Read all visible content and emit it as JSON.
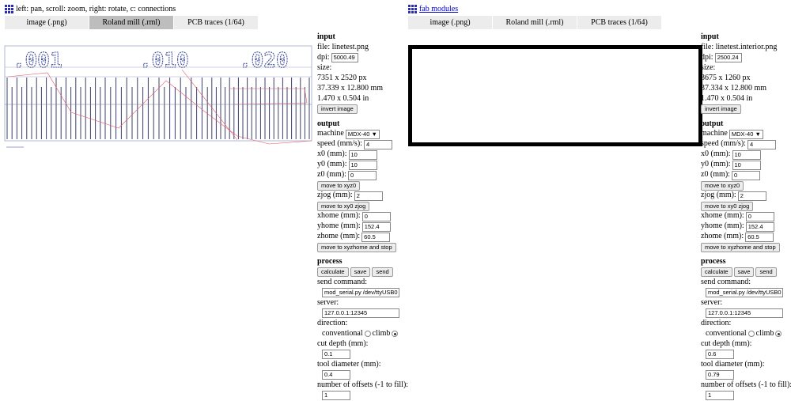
{
  "left": {
    "header": "left: pan, scroll: zoom, right: rotate, c: connections",
    "tabs": [
      "image (.png)",
      "Roland mill (.rml)",
      "PCB traces (1/64)"
    ],
    "preview_labels": [
      ".001",
      ".010",
      ".020"
    ],
    "input": {
      "title": "input",
      "file": "file: linetest.png",
      "dpi_label": "dpi:",
      "dpi": "5000.49",
      "size": "size:",
      "px": "7351 x 2520 px",
      "mm": "37.339 x 12.800 mm",
      "in": "1.470 x 0.504 in",
      "invert": "invert image"
    },
    "output": {
      "title": "output",
      "machine_label": "machine",
      "machine": "MDX-40 ▼",
      "speed_label": "speed (mm/s):",
      "speed": "4",
      "x0_label": "x0 (mm):",
      "x0": "10",
      "y0_label": "y0 (mm):",
      "y0": "10",
      "z0_label": "z0 (mm):",
      "z0": "0",
      "move_xyz0": "move to xyz0",
      "zjog_label": "zjog (mm):",
      "zjog": "2",
      "move_xy0": "move to xy0 zjog",
      "xhome_label": "xhome (mm):",
      "xhome": "0",
      "yhome_label": "yhome (mm):",
      "yhome": "152.4",
      "zhome_label": "zhome (mm):",
      "zhome": "60.5",
      "move_home": "move to xyzhome and stop"
    },
    "process": {
      "title": "process",
      "calculate": "calculate",
      "save": "save",
      "send": "send",
      "send_cmd_label": "send command:",
      "send_cmd": "mod_serial.py /dev/ttyUSB0",
      "server_label": "server:",
      "server": "127.0.0.1:12345",
      "direction_label": "direction:",
      "conventional": "conventional",
      "climb": "climb",
      "cut_depth_label": "cut depth (mm):",
      "cut_depth": "0.1",
      "tool_diam_label": "tool diameter (mm):",
      "tool_diam": "0.4",
      "offsets_label": "number of offsets (-1 to fill):",
      "offsets": "1"
    }
  },
  "right": {
    "header": "fab modules",
    "tabs": [
      "image (.png)",
      "Roland mill (.rml)",
      "PCB traces (1/64)"
    ],
    "input": {
      "title": "input",
      "file": "file: linetest.interior.png",
      "dpi_label": "dpi:",
      "dpi": "2500.24",
      "size": "size:",
      "px": "3675 x 1260 px",
      "mm": "37.334 x 12.800 mm",
      "in": "1.470 x 0.504 in",
      "invert": "invert image"
    },
    "output": {
      "title": "output",
      "machine_label": "machine",
      "machine": "MDX-40 ▼",
      "speed_label": "speed (mm/s):",
      "speed": "4",
      "x0_label": "x0 (mm):",
      "x0": "10",
      "y0_label": "y0 (mm):",
      "y0": "10",
      "z0_label": "z0 (mm):",
      "z0": "0",
      "move_xyz0": "move to xyz0",
      "zjog_label": "zjog (mm):",
      "zjog": "2",
      "move_xy0": "move to xy0 zjog",
      "xhome_label": "xhome (mm):",
      "xhome": "0",
      "yhome_label": "yhome (mm):",
      "yhome": "152.4",
      "zhome_label": "zhome (mm):",
      "zhome": "60.5",
      "move_home": "move to xyzhome and stop"
    },
    "process": {
      "title": "process",
      "calculate": "calculate",
      "save": "save",
      "send": "send",
      "send_cmd_label": "send command:",
      "send_cmd": "mod_serial.py /dev/ttyUSB0",
      "server_label": "server:",
      "server": "127.0.0.1:12345",
      "direction_label": "direction:",
      "conventional": "conventional",
      "climb": "climb",
      "cut_depth_label": "cut depth (mm):",
      "cut_depth": "0.6",
      "tool_diam_label": "tool diameter (mm):",
      "tool_diam": "0.79",
      "offsets_label": "number of offsets (-1 to fill):",
      "offsets": "1"
    }
  }
}
